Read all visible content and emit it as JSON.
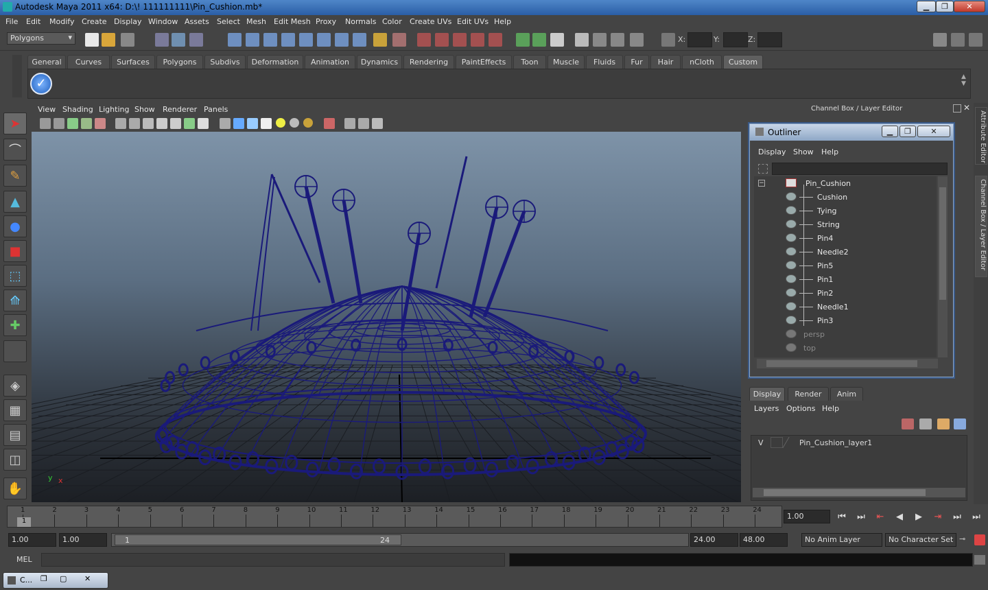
{
  "window": {
    "title": "Autodesk Maya 2011 x64: D:\\! 111111111\\Pin_Cushion.mb*"
  },
  "menu": [
    "File",
    "Edit",
    "Modify",
    "Create",
    "Display",
    "Window",
    "Assets",
    "Select",
    "Mesh",
    "Edit Mesh",
    "Proxy",
    "Normals",
    "Color",
    "Create UVs",
    "Edit UVs",
    "Help"
  ],
  "status": {
    "mode": "Polygons",
    "x_label": "X:",
    "y_label": "Y:",
    "z_label": "Z:"
  },
  "shelf_tabs": [
    "General",
    "Curves",
    "Surfaces",
    "Polygons",
    "Subdivs",
    "Deformation",
    "Animation",
    "Dynamics",
    "Rendering",
    "PaintEffects",
    "Toon",
    "Muscle",
    "Fluids",
    "Fur",
    "Hair",
    "nCloth",
    "Custom"
  ],
  "active_shelf_tab": "Custom",
  "panel_menu": [
    "View",
    "Shading",
    "Lighting",
    "Show",
    "Renderer",
    "Panels"
  ],
  "right_panel": {
    "title": "Channel Box / Layer Editor",
    "side_tabs": [
      "Attribute Editor",
      "Channel Box / Layer Editor"
    ]
  },
  "outliner": {
    "title": "Outliner",
    "menu": [
      "Display",
      "Show",
      "Help"
    ],
    "root": "Pin_Cushion",
    "children": [
      "Cushion",
      "Tying",
      "String",
      "Pin4",
      "Needle2",
      "Pin5",
      "Pin1",
      "Pin2",
      "Needle1",
      "Pin3"
    ],
    "cameras": [
      "persp",
      "top"
    ]
  },
  "layer_editor": {
    "tabs": [
      "Display",
      "Render",
      "Anim"
    ],
    "active_tab": "Display",
    "menu": [
      "Layers",
      "Options",
      "Help"
    ],
    "layer": {
      "visibility": "V",
      "name": "Pin_Cushion_layer1"
    }
  },
  "timeline": {
    "ticks": [
      "1",
      "2",
      "3",
      "4",
      "5",
      "6",
      "7",
      "8",
      "9",
      "10",
      "11",
      "12",
      "13",
      "14",
      "15",
      "16",
      "17",
      "18",
      "19",
      "20",
      "21",
      "22",
      "23",
      "24"
    ],
    "current_frame": "1.00",
    "current_marker": "1"
  },
  "range": {
    "start": "1.00",
    "playback_start": "1.00",
    "slider_start": "1",
    "slider_end": "24",
    "playback_end": "24.00",
    "end": "48.00",
    "anim_layer": "No Anim Layer",
    "character_set": "No Character Set"
  },
  "command_line": {
    "label": "MEL"
  },
  "taskbar": {
    "item": "C..."
  },
  "viewport": {
    "axis_y": "y",
    "axis_x": "x",
    "wire_color": "#1a1a7a"
  }
}
